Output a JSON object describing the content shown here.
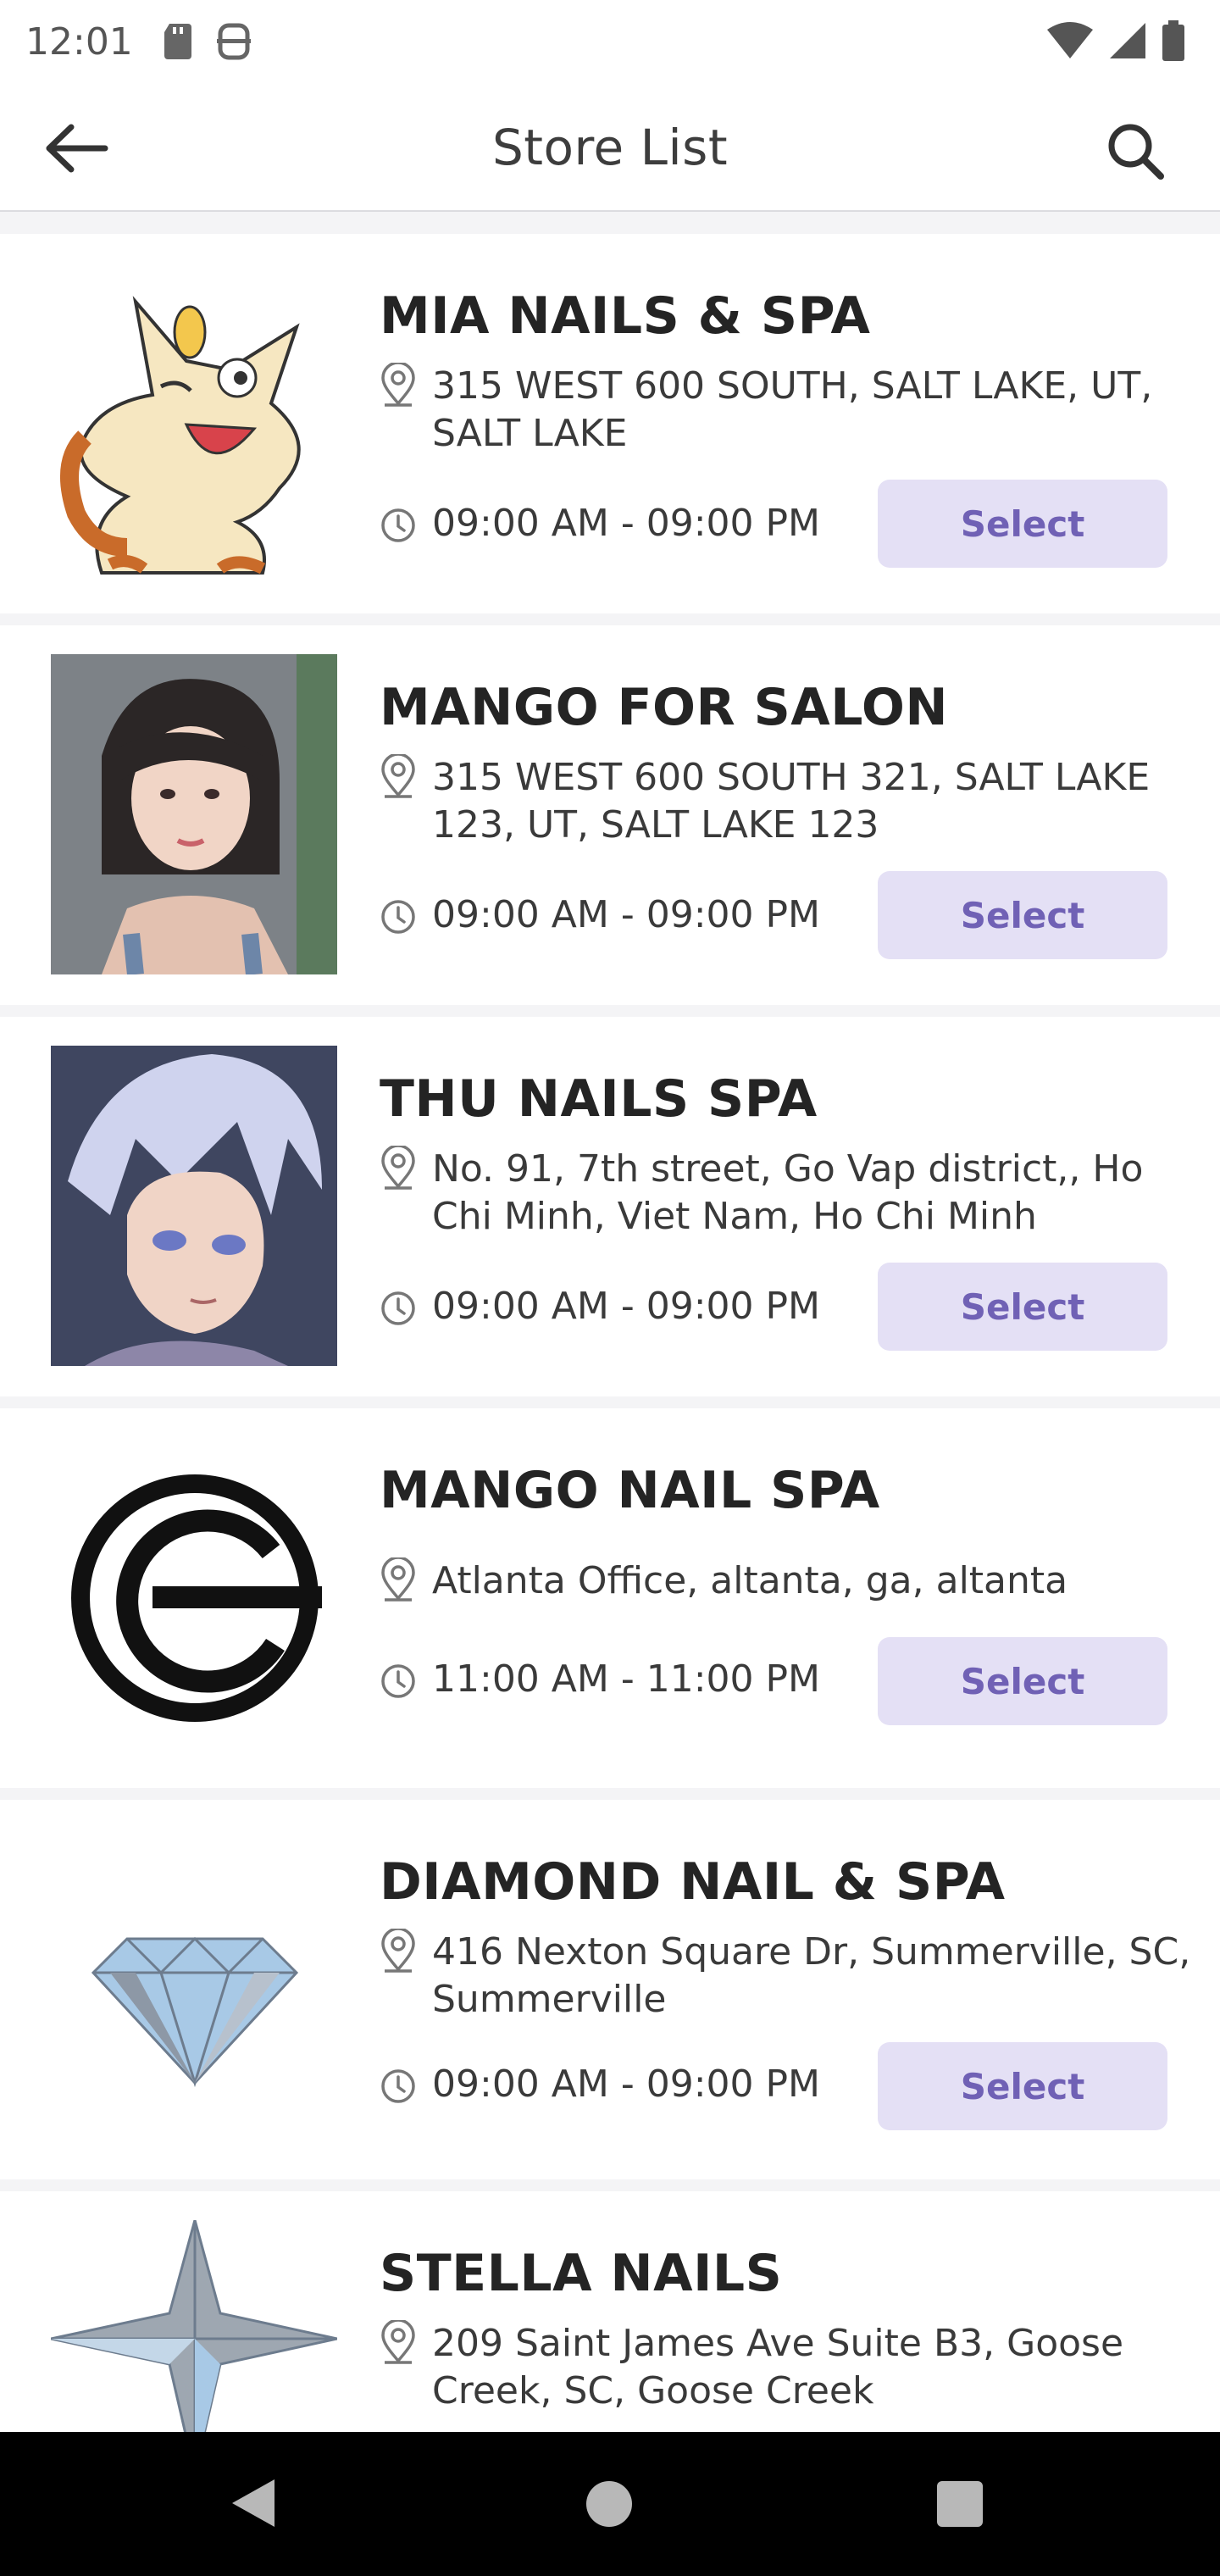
{
  "status_bar": {
    "time": "12:01"
  },
  "app_bar": {
    "title": "Store List"
  },
  "stores": [
    {
      "name": "MIA NAILS & SPA",
      "address": "315 WEST 600 SOUTH, SALT LAKE, UT, SALT LAKE",
      "hours": "09:00 AM - 09:00 PM",
      "select_label": "Select",
      "image": "cartoon-cat-avatar"
    },
    {
      "name": "MANGO FOR SALON",
      "address": "315 WEST 600 SOUTH 321, SALT LAKE 123, UT, SALT LAKE 123",
      "hours": "09:00 AM - 09:00 PM",
      "select_label": "Select",
      "image": "woman-portrait"
    },
    {
      "name": "THU NAILS SPA",
      "address": "No. 91, 7th street, Go Vap district,, Ho Chi Minh, Viet Nam, Ho Chi Minh",
      "hours": "09:00 AM - 09:00 PM",
      "select_label": "Select",
      "image": "anime-character-portrait"
    },
    {
      "name": "MANGO NAIL SPA",
      "address": "Atlanta Office, altanta, ga, altanta",
      "hours": "11:00 AM - 11:00 PM",
      "select_label": "Select",
      "image": "circle-e-logo"
    },
    {
      "name": "DIAMOND NAIL & SPA",
      "address": "416 Nexton Square Dr, Summerville, SC, Summerville",
      "hours": "09:00 AM - 09:00 PM",
      "select_label": "Select",
      "image": "diamond-logo"
    },
    {
      "name": "STELLA NAILS",
      "address": "209 Saint James Ave Suite B3, Goose Creek, SC, Goose Creek",
      "image": "star-logo"
    }
  ],
  "colors": {
    "accent": "#7061b5",
    "button_bg": "#e4e0f5",
    "text": "#242424",
    "background": "#f4f4f6"
  }
}
